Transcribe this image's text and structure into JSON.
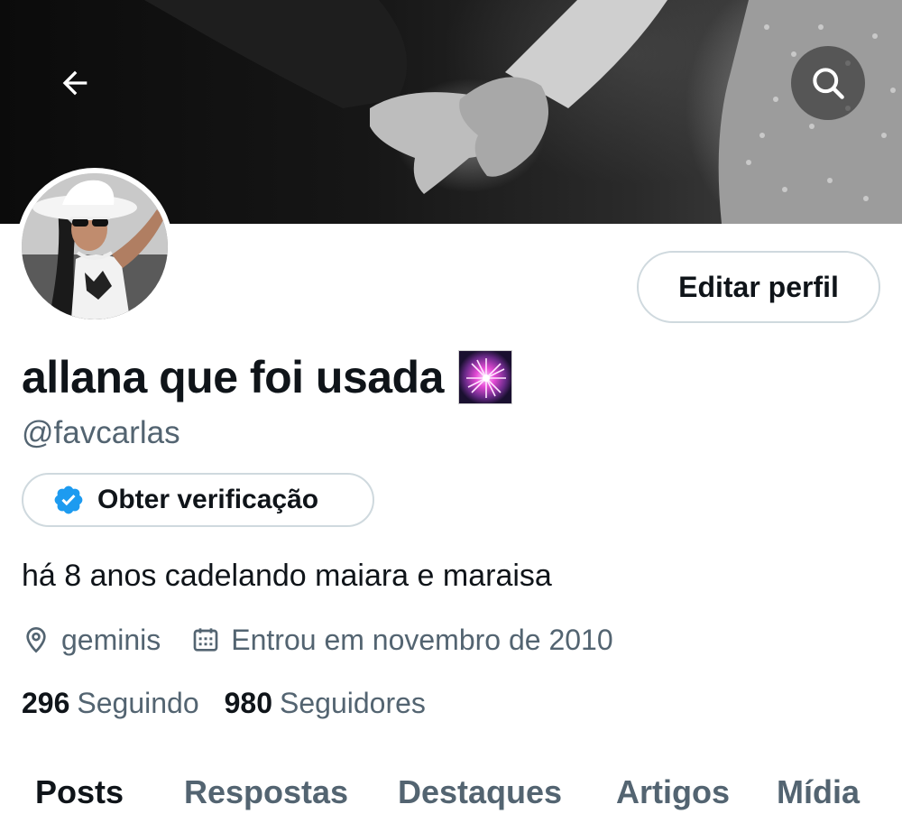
{
  "header": {
    "back_icon": "arrow-left-icon",
    "search_icon": "search-icon"
  },
  "profile": {
    "display_name": "allana que foi usada",
    "name_emoji": "fireworks-emoji",
    "handle": "@favcarlas",
    "edit_button_label": "Editar perfil",
    "verify_button_label": "Obter verificação",
    "verify_icon": "verified-badge-icon",
    "verify_color": "#1d9bf0",
    "bio": "há 8 anos cadelando maiara e maraisa",
    "location": "geminis",
    "location_icon": "location-pin-icon",
    "joined": "Entrou em novembro de 2010",
    "joined_icon": "calendar-icon",
    "following_count": "296",
    "following_label": "Seguindo",
    "followers_count": "980",
    "followers_label": "Seguidores"
  },
  "tabs": [
    {
      "label": "Posts",
      "active": true
    },
    {
      "label": "Respostas",
      "active": false
    },
    {
      "label": "Destaques",
      "active": false
    },
    {
      "label": "Artigos",
      "active": false
    },
    {
      "label": "Mídia",
      "active": false
    }
  ],
  "colors": {
    "text_primary": "#0f1419",
    "text_secondary": "#536471",
    "border": "#cfd9de"
  }
}
